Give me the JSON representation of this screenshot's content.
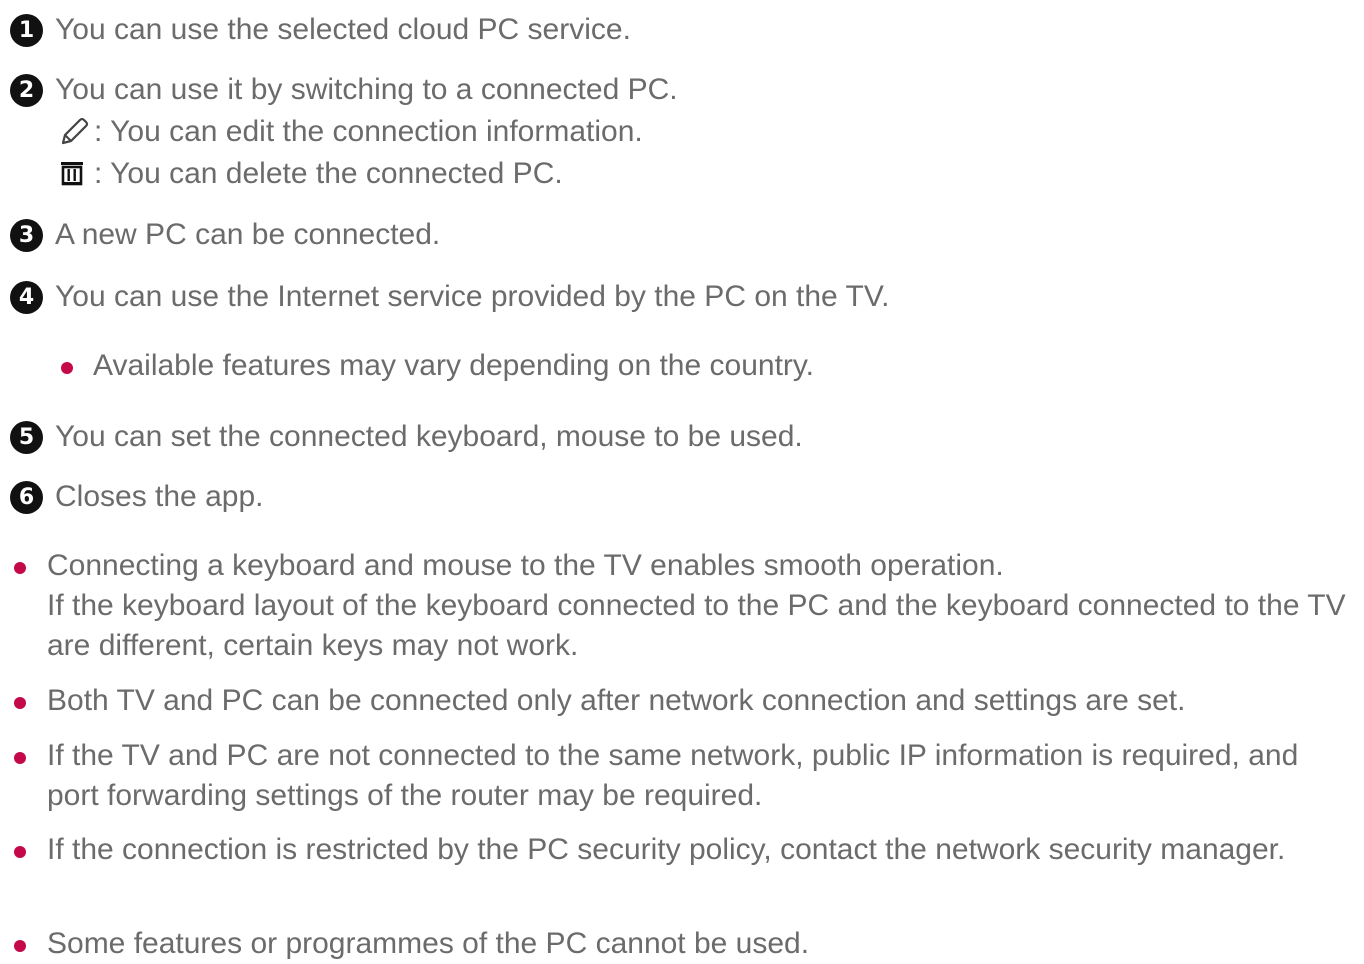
{
  "items": [
    {
      "number": "1",
      "text": "You can use the selected cloud PC service."
    },
    {
      "number": "2",
      "text": "You can use it by switching to a connected PC.",
      "sub": [
        {
          "icon": "pencil-icon",
          "text": ": You can edit the connection information."
        },
        {
          "icon": "trash-icon",
          "text": ": You can delete the connected PC."
        }
      ]
    },
    {
      "number": "3",
      "text": "A new PC can be connected."
    },
    {
      "number": "4",
      "text": "You can use the Internet service provided by the PC on the TV.",
      "note": "Available features may vary depending on the country."
    },
    {
      "number": "5",
      "text": "You can set the connected keyboard, mouse to be used."
    },
    {
      "number": "6",
      "text": "Closes the app."
    }
  ],
  "notes": [
    {
      "line1": "Connecting a keyboard and mouse to the TV enables smooth operation.",
      "line2": "If the keyboard layout of the keyboard connected to the PC and the keyboard connected to the TV are different, certain keys may not work."
    },
    {
      "line1": "Both TV and PC can be connected only after network connection and settings are set."
    },
    {
      "line1": "If the TV and PC are not connected to the same network, public IP information is required, and port forwarding settings of the router may be required."
    },
    {
      "line1": "If the connection is restricted by the PC security policy, contact the network security manager."
    },
    {
      "line1": "Some features or programmes of the PC cannot be used."
    }
  ],
  "colors": {
    "text": "#6b6b6b",
    "bullet": "#c4094a",
    "number_badge": "#111111"
  }
}
